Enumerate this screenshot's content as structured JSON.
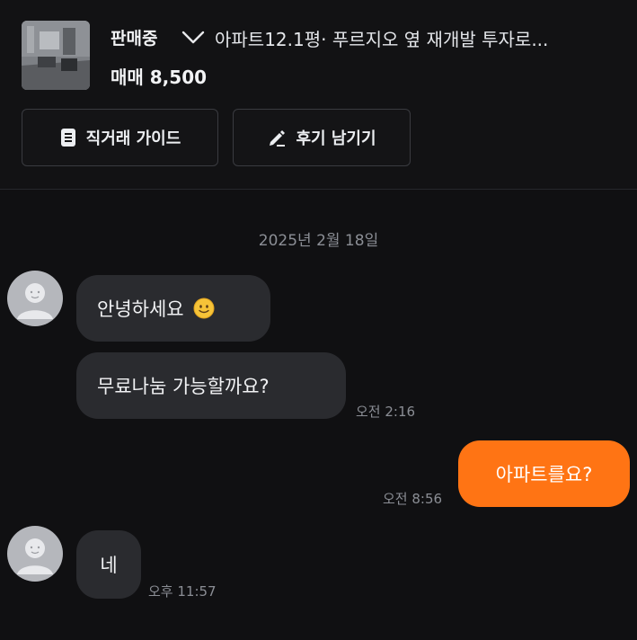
{
  "listing": {
    "status": "판매중",
    "title": "아파트12.1평· 푸르지오 옆 재개발 투자로...",
    "price": "매매 8,500",
    "thumbnail_icon": "room-photo-thumbnail"
  },
  "actions": {
    "guide_label": "직거래 가이드",
    "guide_icon": "document-icon",
    "review_label": "후기 남기기",
    "review_icon": "pencil-icon"
  },
  "chat": {
    "date_divider": "2025년 2월 18일",
    "messages": [
      {
        "sender": "other",
        "text": "안녕하세요",
        "emoji": "slightly-smiling-face"
      },
      {
        "sender": "other",
        "text": "무료나눔 가능할까요?",
        "time": "오전 2:16"
      },
      {
        "sender": "me",
        "text": "아파트를요?",
        "time": "오전 8:56"
      },
      {
        "sender": "other",
        "text": "네",
        "time": "오후 11:57"
      }
    ]
  },
  "colors": {
    "background": "#101012",
    "bubble_other": "#2a2b2f",
    "bubble_mine": "#ff7414",
    "timestamp": "#8b8e95"
  }
}
